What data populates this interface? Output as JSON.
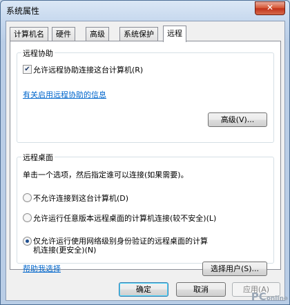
{
  "window": {
    "title": "系统属性",
    "close_glyph": "✕"
  },
  "tabs": [
    {
      "label": "计算机名"
    },
    {
      "label": "硬件"
    },
    {
      "label": "高级"
    },
    {
      "label": "系统保护"
    },
    {
      "label": "远程",
      "active": true
    }
  ],
  "remote_assistance": {
    "group_title": "远程协助",
    "allow_checkbox_label": "允许远程协助连接这台计算机(R)",
    "allow_checked": true,
    "info_link": "有关启用远程协助的信息",
    "advanced_button": "高级(V)..."
  },
  "remote_desktop": {
    "group_title": "远程桌面",
    "instruction": "单击一个选项，然后指定谁可以连接(如果需要)。",
    "options": [
      {
        "label": "不允许连接到这台计算机(D)",
        "selected": false
      },
      {
        "label": "允许运行任意版本远程桌面的计算机连接(较不安全)(L)",
        "selected": false
      },
      {
        "label_line1": "仅允许运行使用网络级别身份验证的远程桌面的计算",
        "label_line2": "机连接(更安全)(N)",
        "selected": true
      }
    ],
    "help_link": "帮助我选择",
    "select_users_button": "选择用户(S)..."
  },
  "dialog_buttons": {
    "ok": "确定",
    "cancel": "取消",
    "apply": "应用(A)"
  },
  "watermark": {
    "text": "PC",
    "suffix": "online"
  },
  "colors": {
    "link": "#0066cc",
    "close_button": "#c1321a",
    "selected_radio": "#1f4f8f"
  }
}
